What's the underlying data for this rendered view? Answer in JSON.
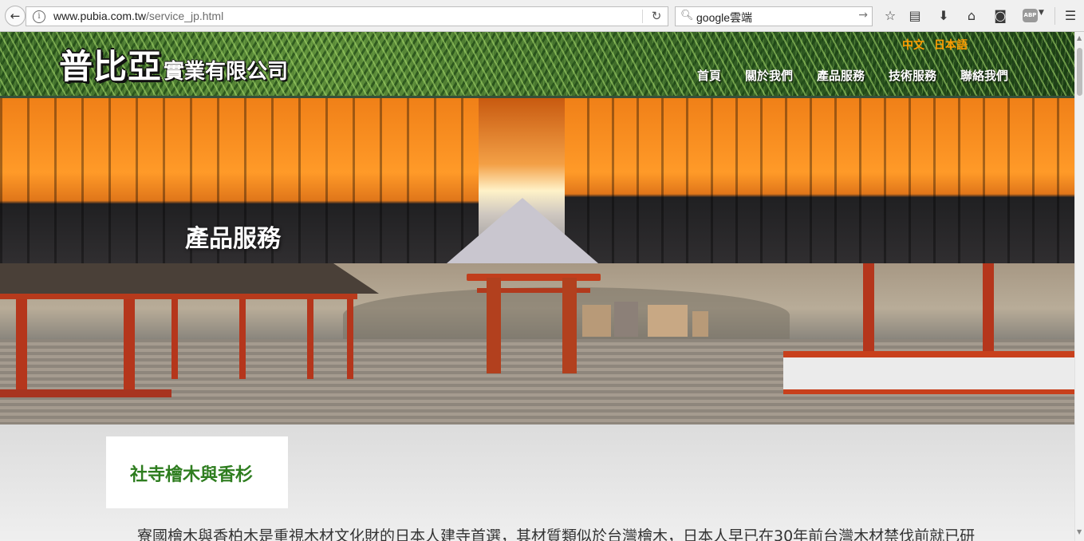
{
  "browser": {
    "url_host": "www.pubia.com.tw",
    "url_path": "/service_jp.html",
    "search_query": "google雲端",
    "abp_label": "ABP"
  },
  "header": {
    "logo_main": "普比亞",
    "logo_sub": "實業有限公司",
    "lang_zh": "中文",
    "lang_ja": "日本語",
    "menu": [
      {
        "label": "首頁"
      },
      {
        "label": "關於我們"
      },
      {
        "label": "產品服務"
      },
      {
        "label": "技術服務"
      },
      {
        "label": "聯絡我們"
      }
    ]
  },
  "hero": {
    "title": "產品服務"
  },
  "content": {
    "subtitle": "社寺檜木與香杉",
    "body": "寮國檜木與香柏木是重視木材文化財的日本人建寺首選，其材質類似於台灣檜木，日本人早已在30年前台灣木材禁伐前就已研"
  },
  "colors": {
    "accent_orange": "#ff9d00",
    "title_green": "#2e7d1f"
  }
}
